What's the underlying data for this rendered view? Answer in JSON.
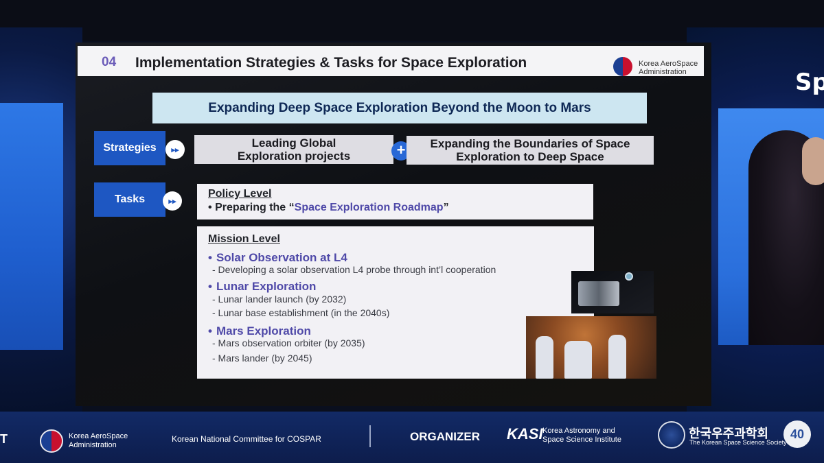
{
  "slide": {
    "section_number": "04",
    "section_title": "Implementation Strategies & Tasks for Space Exploration",
    "org_logo_text": [
      "Korea AeroSpace",
      "Administration"
    ],
    "banner": "Expanding Deep Space Exploration Beyond the Moon to Mars",
    "strategies": {
      "label": "Strategies",
      "items": [
        [
          "Leading Global",
          "Exploration projects"
        ],
        [
          "Expanding the Boundaries of Space",
          "Exploration to Deep Space"
        ]
      ],
      "connector_symbol": "+"
    },
    "tasks": {
      "label": "Tasks",
      "policy": {
        "heading": "Policy Level",
        "bullet_prefix": "Preparing the “",
        "bullet_highlight": "Space Exploration Roadmap",
        "bullet_suffix": "”"
      },
      "mission": {
        "heading": "Mission Level",
        "groups": [
          {
            "title": "Solar Observation at L4",
            "items": [
              "- Developing a solar observation L4 probe through int’l cooperation"
            ]
          },
          {
            "title": "Lunar Exploration",
            "items": [
              "- Lunar lander launch (by 2032)",
              "- Lunar base establishment (in the 2040s)"
            ]
          },
          {
            "title": "Mars Exploration",
            "items": [
              "- Mars observation orbiter (by 2035)",
              "- Mars lander (by 2045)"
            ]
          }
        ]
      }
    },
    "arrow_symbol": "▸▸",
    "bullet_symbol": "•"
  },
  "footer": {
    "edge_letter": "T",
    "kasa": [
      "Korea AeroSpace",
      "Administration"
    ],
    "cospar": "Korean National Committee for COSPAR",
    "organizer": "ORGANIZER",
    "kasi_mark": "KASI",
    "kasi_name": [
      "Korea Astronomy and",
      "Space Science Institute"
    ],
    "kss_korean": "한국우주과학회",
    "kss_english": "The Korean Space Science Society",
    "anniversary": "40"
  },
  "background": {
    "partial_brand_text": "Sp"
  },
  "colors": {
    "accent_blue": "#1e57c2",
    "banner_bg": "#cde6f1",
    "highlight_purple": "#4f49a8"
  }
}
